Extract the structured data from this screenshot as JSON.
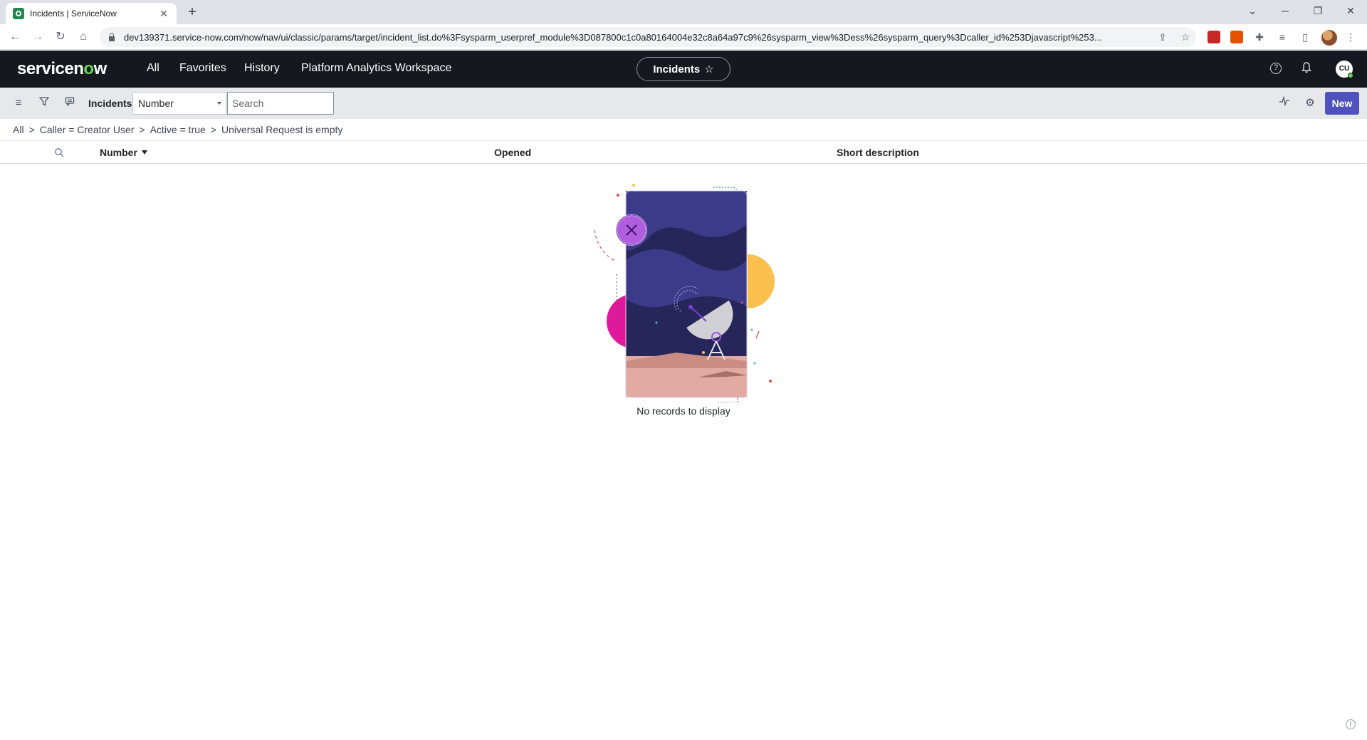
{
  "browser": {
    "tab_title": "Incidents | ServiceNow",
    "tab_close": "✕",
    "new_tab": "+",
    "url": "dev139371.service-now.com/now/nav/ui/classic/params/target/incident_list.do%3Fsysparm_userpref_module%3D087800c1c0a80164004e32c8a64a97c9%26sysparm_view%3Dess%26sysparm_query%3Dcaller_id%253Djavascript%253..."
  },
  "header": {
    "logo_text_pre": "servicen",
    "logo_text_o": "o",
    "logo_text_post": "w",
    "nav": [
      "All",
      "Favorites",
      "History",
      "Platform Analytics Workspace"
    ],
    "context_pill": "Incidents",
    "avatar_initials": "CU"
  },
  "toolbar": {
    "list_title": "Incidents",
    "field_select": "Number",
    "search_placeholder": "Search",
    "new_button": "New"
  },
  "breadcrumb": [
    "All",
    "Caller = Creator User",
    "Active = true",
    "Universal Request is empty"
  ],
  "table": {
    "columns": [
      "Number",
      "Opened",
      "Short description"
    ],
    "sorted_column": "Number",
    "rows": []
  },
  "empty_state": {
    "message": "No records to display"
  },
  "colors": {
    "header_bg": "#17181f",
    "brand_green": "#62d84e",
    "primary_button": "#4f52bd",
    "toolbar_bg": "#e6e8ec"
  }
}
